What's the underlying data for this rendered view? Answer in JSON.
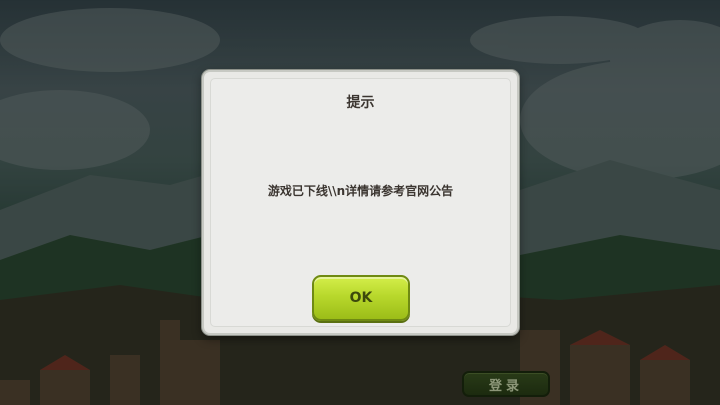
{
  "background": {
    "login_button_label": "登录"
  },
  "dialog": {
    "title": "提示",
    "message": "游戏已下线\\\\n详情请参考官网公告",
    "ok_label": "OK"
  },
  "colors": {
    "dialog_bg": "#ececea",
    "ok_button": "#b8d82c",
    "text": "#3b3530"
  }
}
